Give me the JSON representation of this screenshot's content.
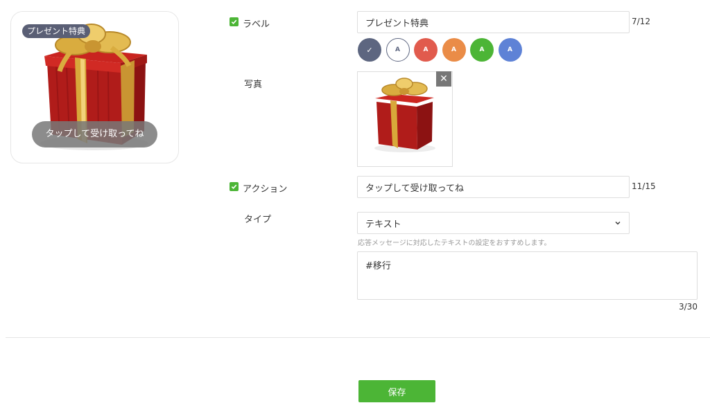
{
  "preview": {
    "label_badge": "プレゼント特典",
    "action_button": "タップして受け取ってね"
  },
  "label_section": {
    "title": "ラベル",
    "value": "プレゼント特典",
    "counter": "7/12",
    "swatches": [
      {
        "text": "✓",
        "color": "#5d6680",
        "selected": true
      },
      {
        "text": "A",
        "color": "#ffffff",
        "selected": false
      },
      {
        "text": "A",
        "color": "#e15b4d",
        "selected": false
      },
      {
        "text": "A",
        "color": "#ea8c47",
        "selected": false
      },
      {
        "text": "A",
        "color": "#4cb536",
        "selected": false
      },
      {
        "text": "A",
        "color": "#5e82d6",
        "selected": false
      }
    ]
  },
  "photo_section": {
    "title": "写真",
    "remove_glyph": "✕"
  },
  "action_section": {
    "title": "アクション",
    "value": "タップして受け取ってね",
    "counter": "11/15"
  },
  "type_section": {
    "title": "タイプ",
    "selected": "テキスト",
    "hint": "応答メッセージに対応したテキストの設定をおすすめします。",
    "text_value": "#移行",
    "text_counter": "3/30"
  },
  "footer": {
    "save_label": "保存"
  },
  "colors": {
    "accent": "#4cb536",
    "badge": "#5a5f75"
  }
}
